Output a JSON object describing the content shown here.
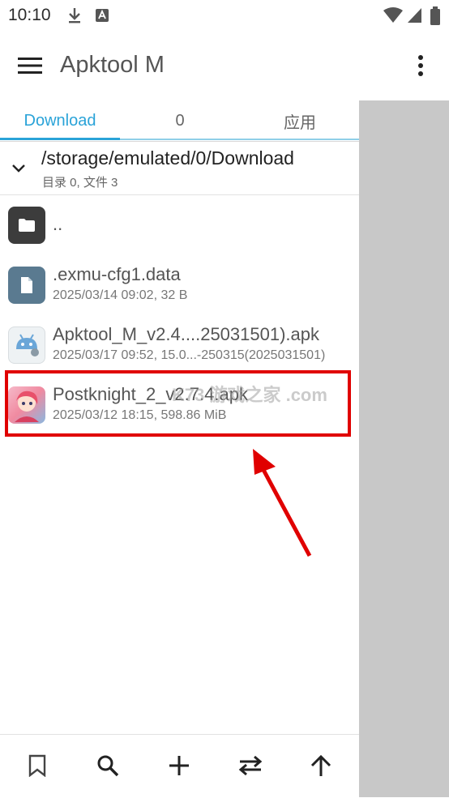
{
  "status_bar": {
    "time": "10:10"
  },
  "app_bar": {
    "title": "Apktool M"
  },
  "tabs": [
    {
      "label": "Download",
      "active": true
    },
    {
      "label": "0",
      "active": false
    },
    {
      "label": "应用",
      "active": false
    }
  ],
  "path": {
    "current": "/storage/emulated/0/Download",
    "summary": "目录 0, 文件 3"
  },
  "files": [
    {
      "name": "..",
      "meta": "",
      "icon": "folder-icon"
    },
    {
      "name": ".exmu-cfg1.data",
      "meta": "2025/03/14 09:02, 32 B",
      "icon": "document-icon"
    },
    {
      "name": "Apktool_M_v2.4....25031501).apk",
      "meta": "2025/03/17 09:52, 15.0...-250315(2025031501)",
      "icon": "android-apk-icon"
    },
    {
      "name": "Postknight_2_v2.7.4.apk",
      "meta": "2025/03/12 18:15, 598.86 MiB",
      "icon": "game-app-icon"
    }
  ],
  "watermark": "K73 游戏之家 .com",
  "colors": {
    "accent": "#2aa3d8",
    "highlight": "#e00000",
    "overlay": "#c8c8c8"
  },
  "bottom_bar": [
    "bookmark-icon",
    "search-icon",
    "add-icon",
    "swap-icon",
    "arrow-up-icon"
  ]
}
